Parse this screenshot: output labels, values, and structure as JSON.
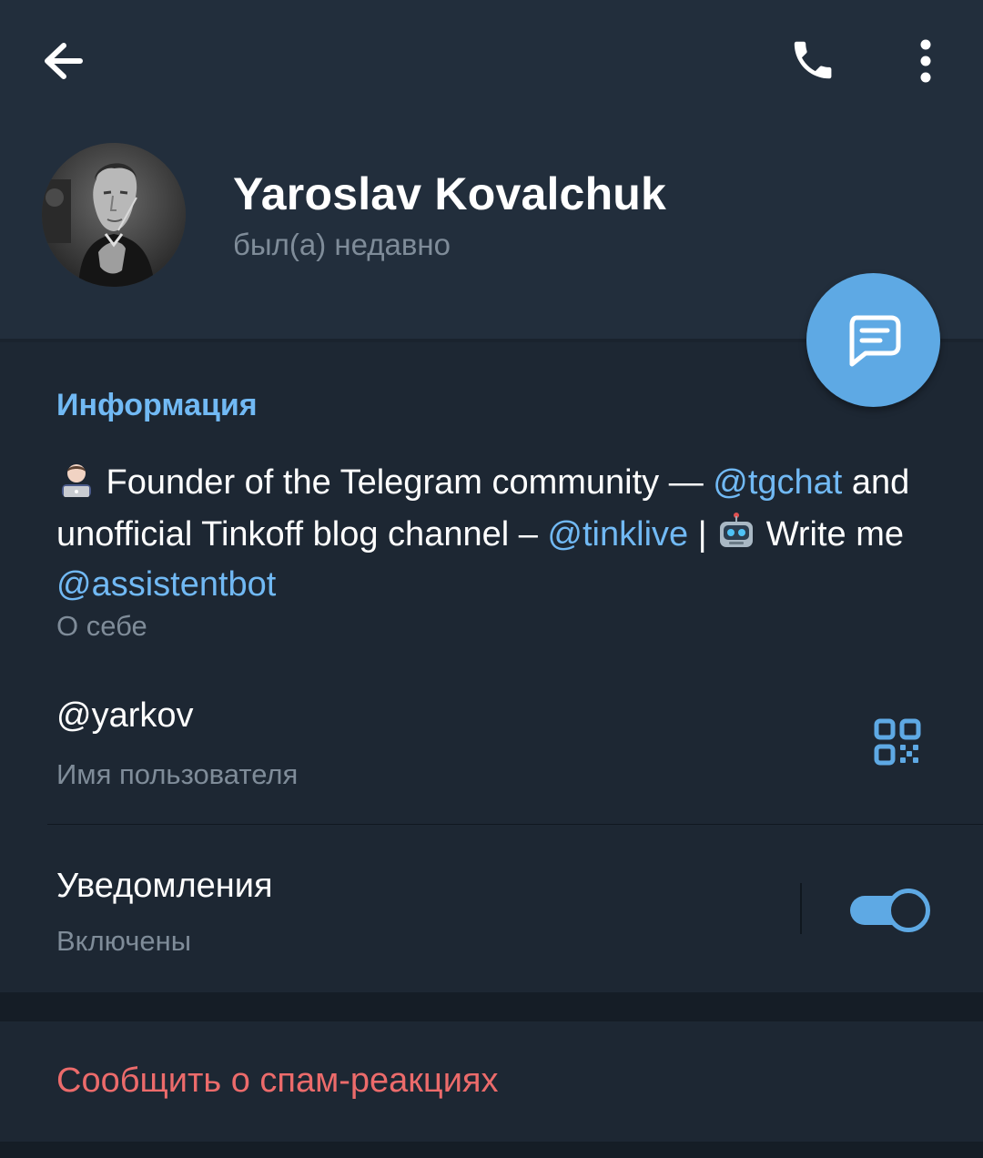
{
  "toolbar": {
    "back_icon": "arrow-left-icon",
    "call_icon": "phone-icon",
    "more_icon": "more-vertical-icon"
  },
  "profile": {
    "name": "Yaroslav Kovalchuk",
    "status": "был(а) недавно"
  },
  "fab": {
    "icon": "message-icon"
  },
  "info": {
    "title": "Информация",
    "bio": {
      "part1": " Founder of the Telegram community — ",
      "link1": "@tgchat",
      "part2": " and unofficial Tinkoff blog channel – ",
      "link2": "@tinklive",
      "part3": " | ",
      "part4": " Write me ",
      "link3": "@assistentbot"
    },
    "bio_caption": "О себе",
    "username": "@yarkov",
    "username_caption": "Имя пользователя",
    "notifications_title": "Уведомления",
    "notifications_caption": "Включены",
    "notifications_enabled": true
  },
  "report": {
    "label": "Сообщить о спам-реакциях"
  },
  "colors": {
    "accent": "#5ea9e4",
    "link": "#71b9f4",
    "danger": "#ec6b6b",
    "background": "#1d2733",
    "header": "#222e3c",
    "secondary_text": "#7f8c99"
  }
}
